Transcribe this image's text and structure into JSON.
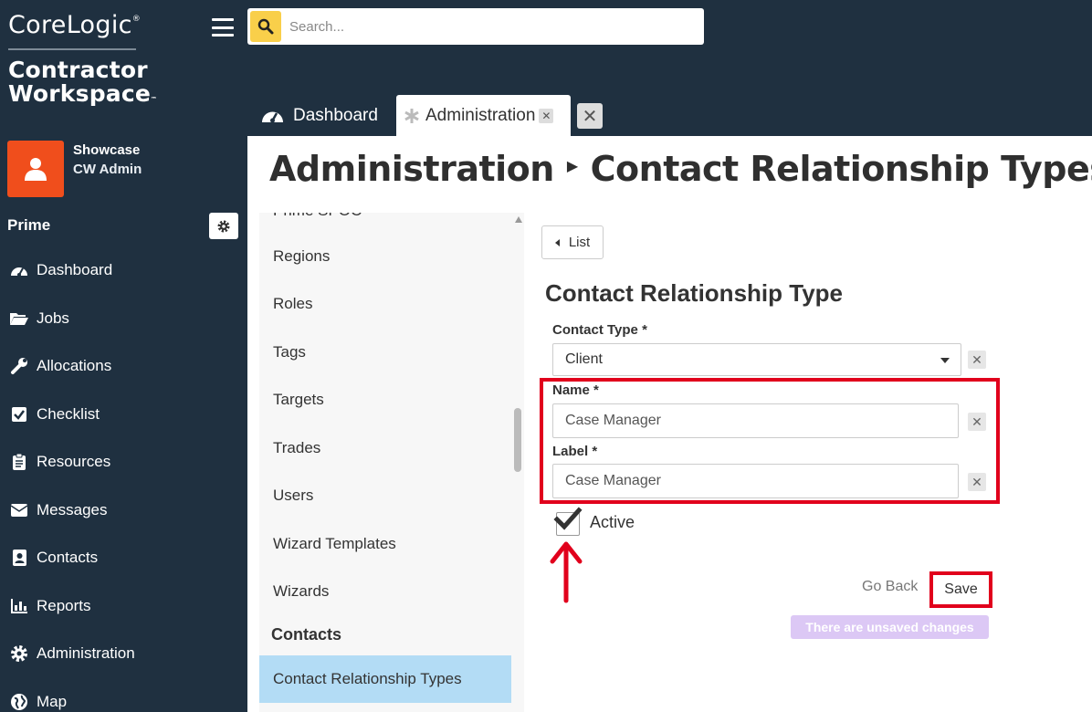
{
  "brand": {
    "logo_line1": "CoreLogic",
    "logo_line2a": "Contractor",
    "logo_line2b": "Workspace"
  },
  "user": {
    "name": "Showcase",
    "role": "CW Admin"
  },
  "sidebar": {
    "section_title": "Prime",
    "items": [
      {
        "label": "Dashboard",
        "icon": "speedometer-icon"
      },
      {
        "label": "Jobs",
        "icon": "folder-open-icon"
      },
      {
        "label": "Allocations",
        "icon": "wrench-icon"
      },
      {
        "label": "Checklist",
        "icon": "checkbox-icon"
      },
      {
        "label": "Resources",
        "icon": "clipboard-icon"
      },
      {
        "label": "Messages",
        "icon": "envelope-icon"
      },
      {
        "label": "Contacts",
        "icon": "address-book-icon"
      },
      {
        "label": "Reports",
        "icon": "bar-chart-icon"
      },
      {
        "label": "Administration",
        "icon": "gear-icon"
      },
      {
        "label": "Map",
        "icon": "globe-icon"
      }
    ]
  },
  "search": {
    "placeholder": "Search..."
  },
  "tabs": [
    {
      "label": "Dashboard",
      "icon": "speedometer-icon"
    },
    {
      "label": "Administration",
      "icon": "asterisk-icon"
    }
  ],
  "breadcrumb": {
    "parent": "Administration",
    "current": "Contact Relationship Types"
  },
  "subnav": {
    "cut_item": "Prime SPOC",
    "items": [
      "Regions",
      "Roles",
      "Tags",
      "Targets",
      "Trades",
      "Users",
      "Wizard Templates",
      "Wizards"
    ],
    "heading": "Contacts",
    "active_item": "Contact Relationship Types"
  },
  "form": {
    "list_button": "List",
    "title": "Contact Relationship Type",
    "contact_type_label": "Contact Type *",
    "contact_type_value": "Client",
    "name_label": "Name *",
    "name_value": "Case Manager",
    "label_label": "Label *",
    "label_value": "Case Manager",
    "active_label": "Active",
    "active_checked": true,
    "go_back": "Go Back",
    "save": "Save",
    "unsaved_notice": "There are unsaved changes"
  },
  "colors": {
    "sidebar_bg": "#1f3040",
    "accent_orange": "#f04e1c",
    "search_yellow": "#f9cf4a",
    "highlight_red": "#e1001c",
    "active_blue": "#b3dcf5",
    "unsaved_purple": "#dcc8f5"
  }
}
